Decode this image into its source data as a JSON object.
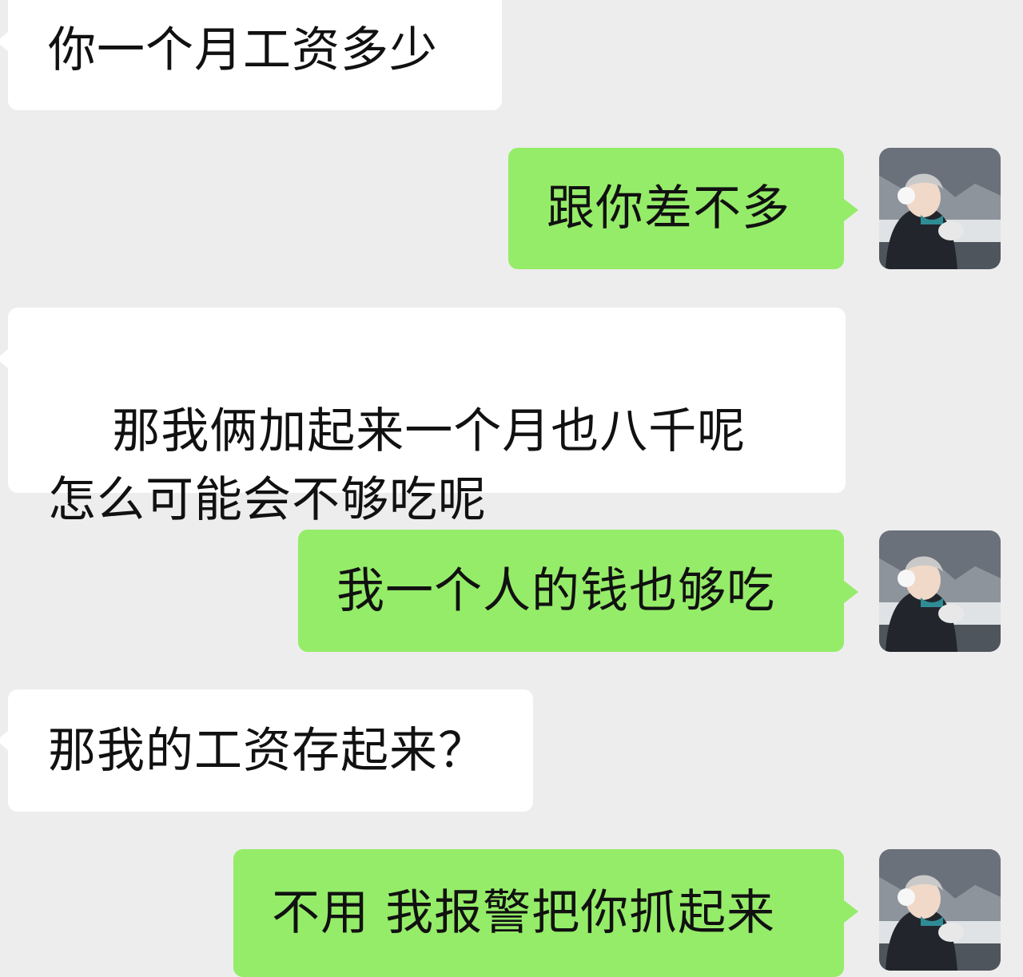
{
  "messages": [
    {
      "side": "incoming",
      "text": "你一个月工资多少"
    },
    {
      "side": "outgoing",
      "text": "跟你差不多"
    },
    {
      "side": "incoming",
      "text": "那我俩加起来一个月也八千呢  怎么可能会不够吃呢"
    },
    {
      "side": "outgoing",
      "text": "我一个人的钱也够吃"
    },
    {
      "side": "incoming",
      "text": "那我的工资存起来？"
    },
    {
      "side": "outgoing",
      "text": "不用 我报警把你抓起来"
    }
  ],
  "colors": {
    "background": "#ededed",
    "incoming_bubble": "#ffffff",
    "outgoing_bubble": "#95ec69",
    "text": "#111111"
  },
  "icons": {
    "avatar": "user-avatar-photo"
  }
}
